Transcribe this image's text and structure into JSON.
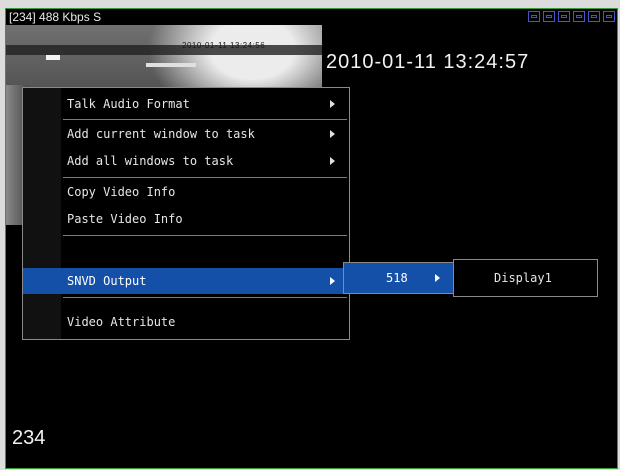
{
  "window": {
    "title": "[234]  488 Kbps S",
    "icons": [
      "layout-single-icon",
      "layout-quad-icon",
      "layout-multi-icon",
      "record-icon",
      "audio-icon",
      "close-icon"
    ]
  },
  "video": {
    "overlay_timestamp": "2010-01-11 13:24:57",
    "overlay_stamp_small": "2010-01-11  13:24:56",
    "channel_label": "234"
  },
  "context_menu": {
    "items": [
      {
        "label": "Talk Audio Format",
        "has_submenu": true
      },
      {
        "label": "Add current window to task",
        "has_submenu": true
      },
      {
        "label": "Add all windows to task",
        "has_submenu": true
      },
      {
        "label": "Copy Video Info",
        "has_submenu": false
      },
      {
        "label": "Paste Video Info",
        "has_submenu": false
      },
      {
        "label": "SNVD Output",
        "has_submenu": true,
        "selected": true
      },
      {
        "label": "Video Attribute",
        "has_submenu": false
      }
    ]
  },
  "submenu_snvd": {
    "items": [
      {
        "label": "518",
        "has_submenu": true,
        "selected": true
      }
    ]
  },
  "submenu_518": {
    "items": [
      {
        "label": "Display1"
      }
    ]
  },
  "colors": {
    "selection": "#1450a8",
    "frame_border": "#3a9a3a",
    "title_icons": "#4a52c8"
  }
}
